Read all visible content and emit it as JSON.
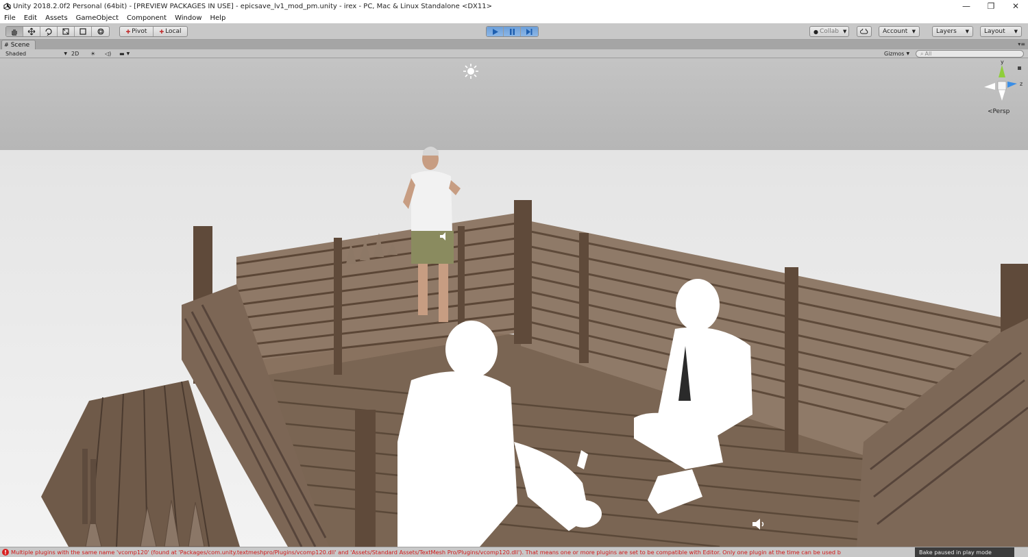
{
  "window": {
    "title": "Unity 2018.2.0f2 Personal (64bit) - [PREVIEW PACKAGES IN USE] - epicsave_lv1_mod_pm.unity - irex - PC, Mac & Linux Standalone <DX11>",
    "controls": {
      "minimize": "—",
      "maximize": "❐",
      "close": "✕"
    }
  },
  "menu": {
    "items": [
      {
        "label": "File"
      },
      {
        "label": "Edit"
      },
      {
        "label": "Assets"
      },
      {
        "label": "GameObject"
      },
      {
        "label": "Component"
      },
      {
        "label": "Window"
      },
      {
        "label": "Help"
      }
    ]
  },
  "toolbar": {
    "transform_tools": [
      "hand-icon",
      "move-icon",
      "rotate-icon",
      "scale-icon",
      "rect-icon",
      "transform-icon"
    ],
    "pivot_label": "Pivot",
    "local_label": "Local",
    "play_state": "playing",
    "paused": true,
    "collab_label": "Collab",
    "account_label": "Account",
    "layers_label": "Layers",
    "layout_label": "Layout",
    "play_accent": "#4a86c8"
  },
  "scene": {
    "tab_label": "Scene",
    "shading_mode": "Shaded",
    "mode_2d_label": "2D",
    "gizmos_label": "Gizmos",
    "search_placeholder": "All",
    "projection_label": "Persp",
    "gizmo_axes": {
      "y": "y",
      "z": "z"
    }
  },
  "status": {
    "error_message": "Multiple plugins with the same name 'vcomp120' (found at 'Packages/com.unity.textmeshpro/Plugins/vcomp120.dll' and 'Assets/Standard Assets/TextMesh Pro/Plugins/vcomp120.dll'). That means one or more plugins are set to be compatible with Editor. Only one plugin at the time can be used b",
    "bake_status": "Bake paused in play mode",
    "error_color": "#d01818"
  }
}
